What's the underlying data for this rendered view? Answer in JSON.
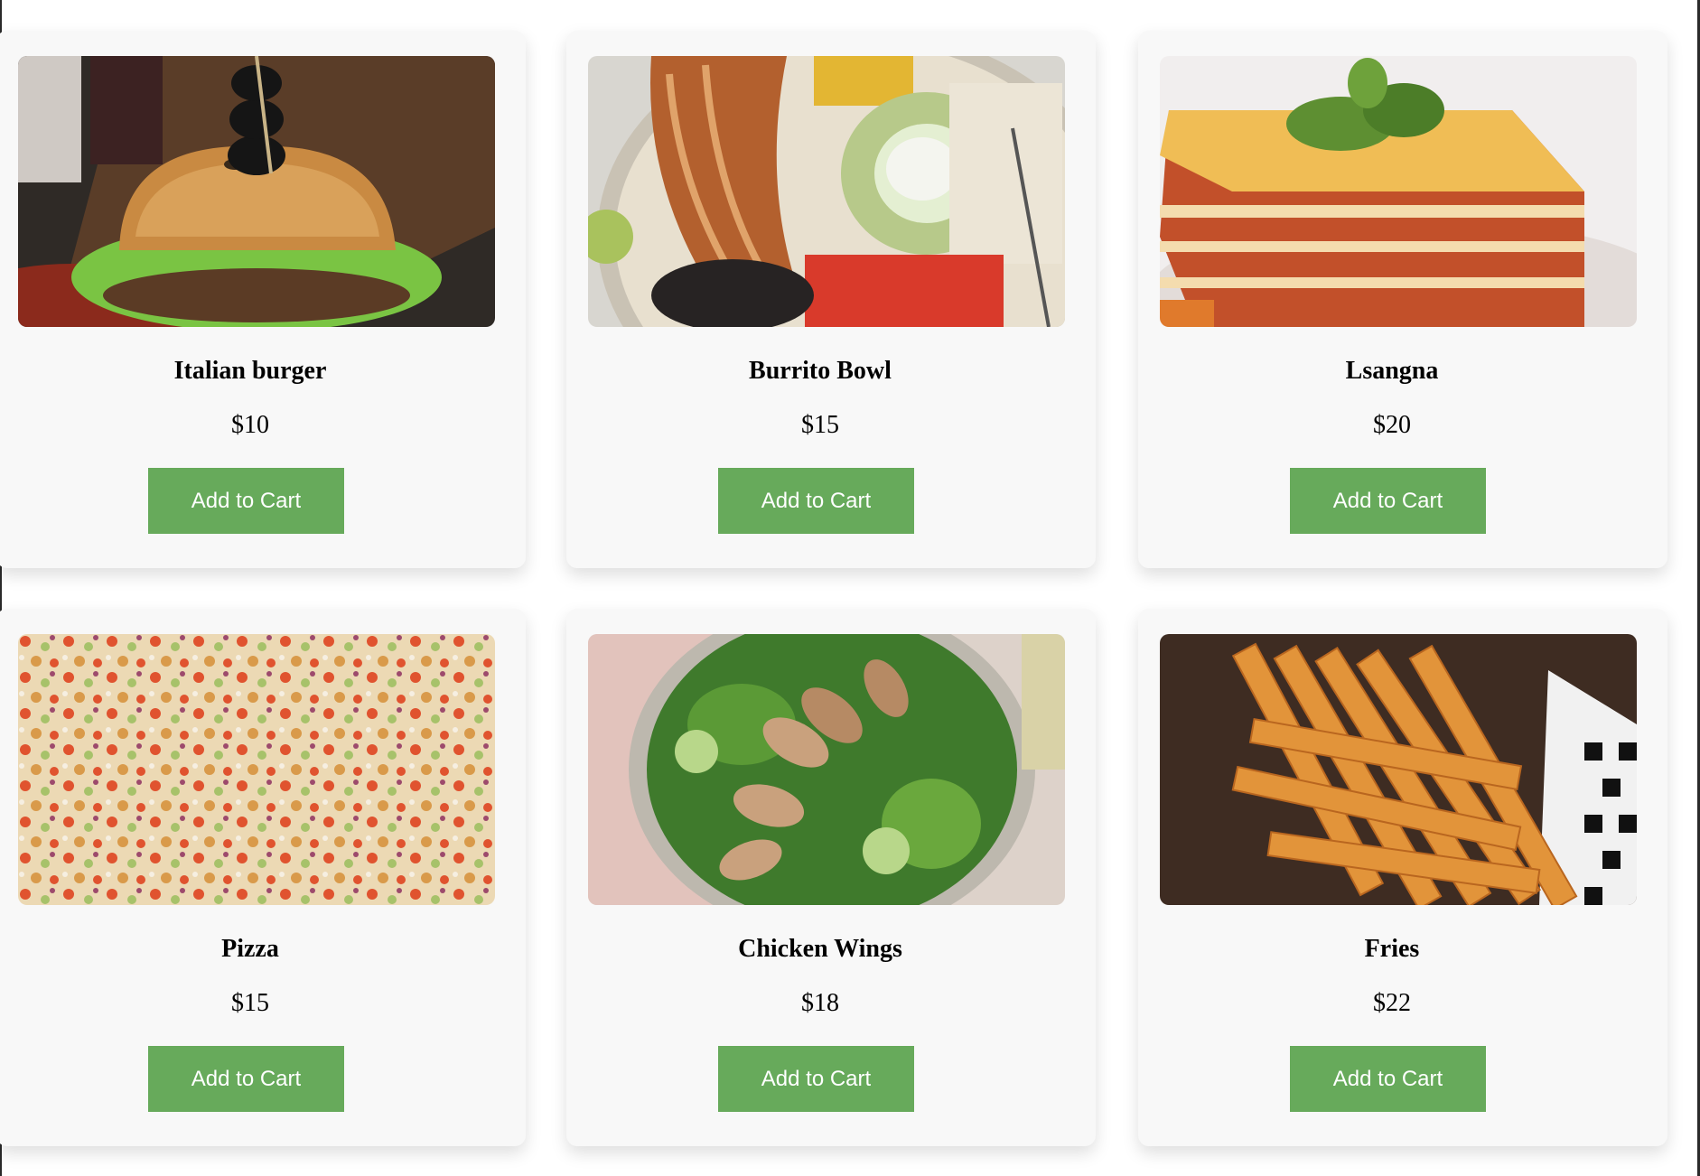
{
  "menu": {
    "items": [
      {
        "name": "Italian burger",
        "price": "$10",
        "button_label": "Add to Cart",
        "image_icon": "burger-photo"
      },
      {
        "name": "Burrito Bowl",
        "price": "$15",
        "button_label": "Add to Cart",
        "image_icon": "burrito-bowl-photo"
      },
      {
        "name": "Lsangna",
        "price": "$20",
        "button_label": "Add to Cart",
        "image_icon": "lasagna-photo"
      },
      {
        "name": "Pizza",
        "price": "$15",
        "button_label": "Add to Cart",
        "image_icon": "pizza-photo"
      },
      {
        "name": "Chicken Wings",
        "price": "$18",
        "button_label": "Add to Cart",
        "image_icon": "chicken-salad-photo"
      },
      {
        "name": "Fries",
        "price": "$22",
        "button_label": "Add to Cart",
        "image_icon": "fries-photo"
      }
    ]
  },
  "colors": {
    "button": "#67aa5b",
    "card": "#f8f8f8",
    "page": "#ffffff"
  }
}
